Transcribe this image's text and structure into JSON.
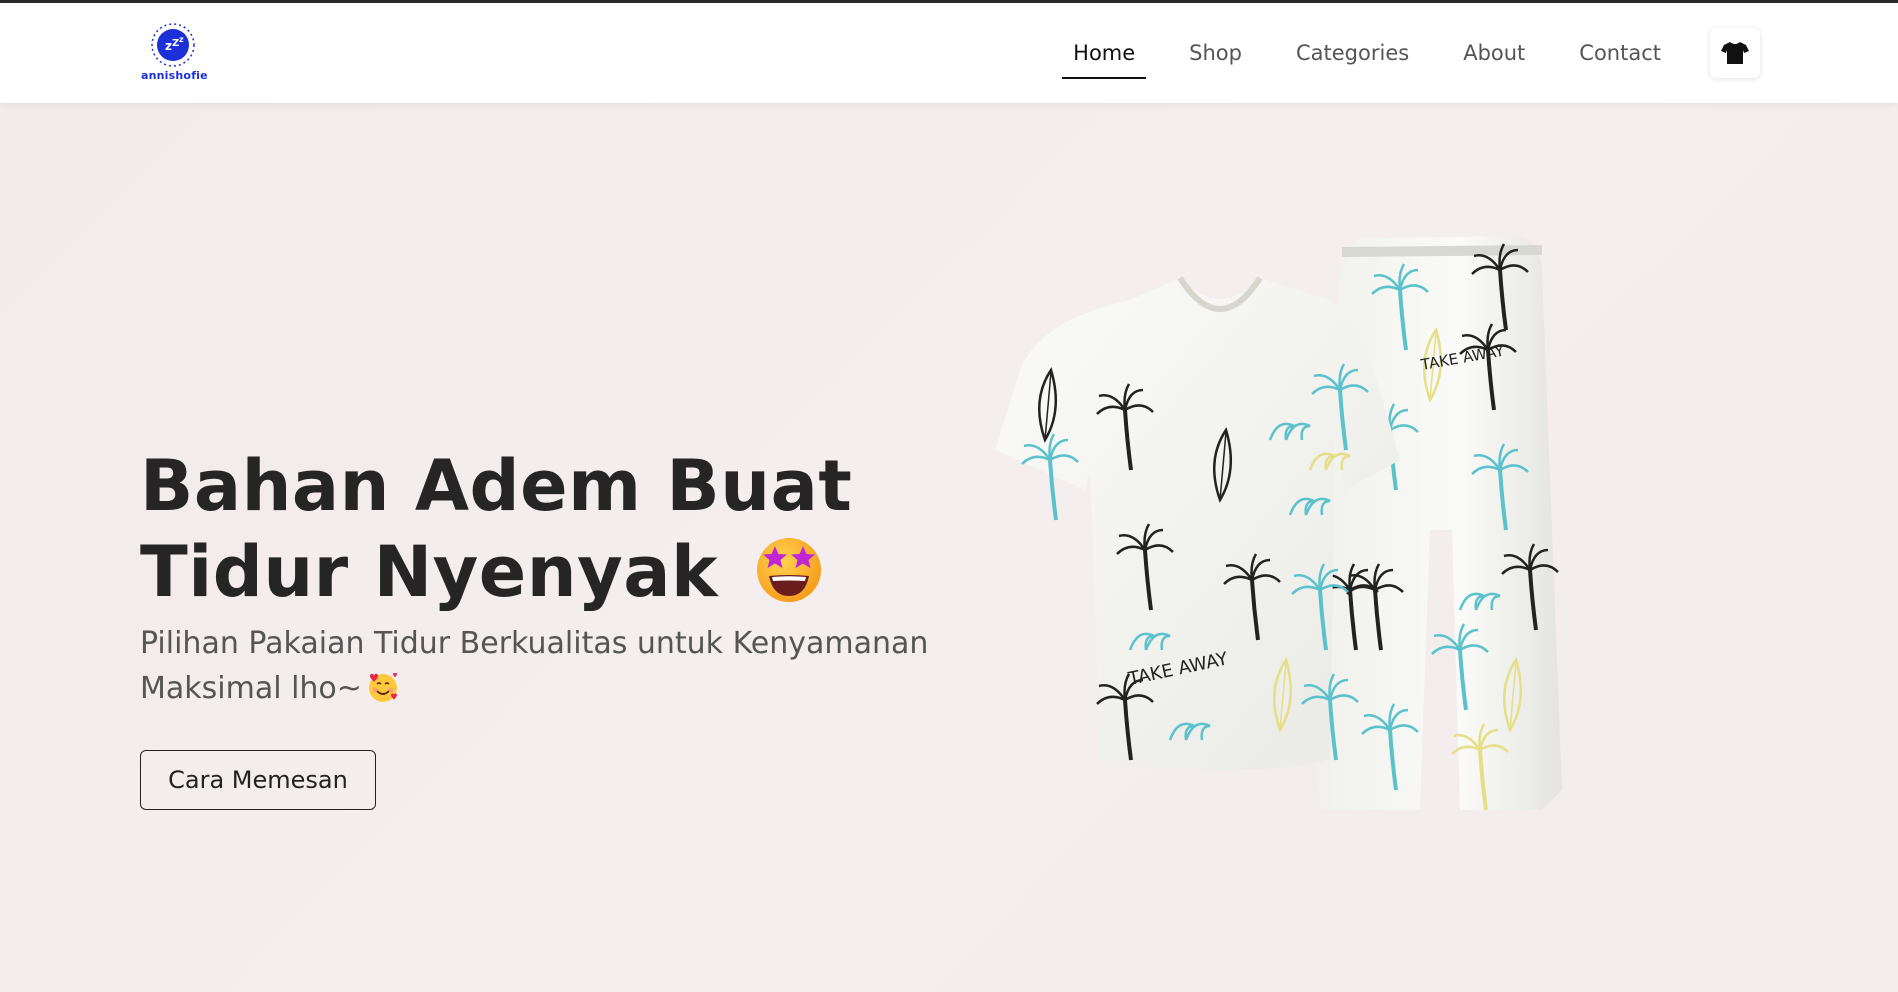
{
  "brand": {
    "logo_icon": "zzz-moon-icon",
    "name": "annishofie"
  },
  "nav": {
    "items": [
      {
        "label": "Home",
        "active": true
      },
      {
        "label": "Shop",
        "active": false
      },
      {
        "label": "Categories",
        "active": false
      },
      {
        "label": "About",
        "active": false
      },
      {
        "label": "Contact",
        "active": false
      }
    ],
    "cart_icon": "tshirt-icon"
  },
  "hero": {
    "title_line1": "Bahan Adem Buat",
    "title_line2": "Tidur Nyenyak",
    "title_emoji": "star-struck-emoji",
    "subtitle_line1": "Pilihan Pakaian Tidur Berkualitas untuk Kenyamanan",
    "subtitle_line2": "Maksimal lho~",
    "subtitle_emoji": "smiling-face-with-hearts-emoji",
    "cta_label": "Cara Memesan",
    "product_print_text": "TAKE AWAY"
  },
  "colors": {
    "accent_blue": "#1d2fd6",
    "text_dark": "#252525",
    "hero_bg": "#f4eded"
  }
}
